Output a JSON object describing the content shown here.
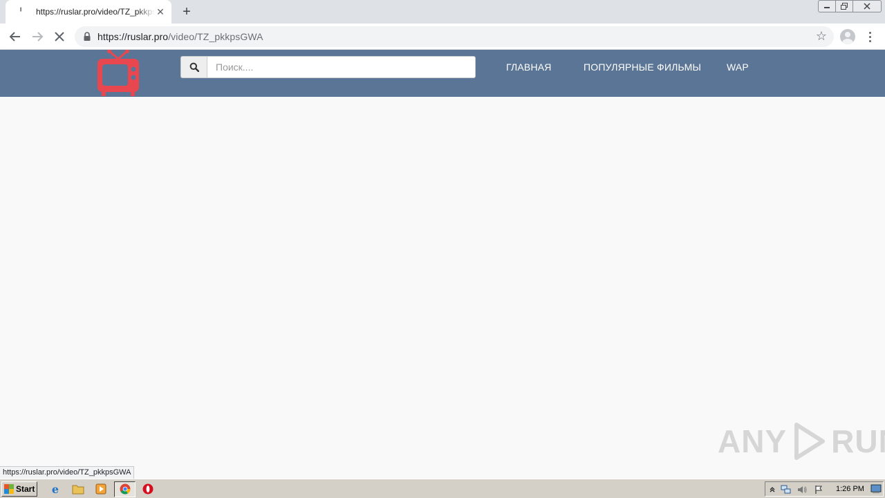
{
  "browser": {
    "tab": {
      "title": "https://ruslar.pro/video/TZ_pkkpsGWA",
      "close_glyph": "✕"
    },
    "new_tab_glyph": "+",
    "address": {
      "url_main": "https://ruslar.pro",
      "url_path": "/video/TZ_pkkpsGWA"
    },
    "status_text": "https://ruslar.pro/video/TZ_pkkpsGWA"
  },
  "site": {
    "search": {
      "placeholder": "Поиск...."
    },
    "nav": {
      "home": "ГЛАВНАЯ",
      "popular": "ПОПУЛЯРНЫЕ ФИЛЬМЫ",
      "wap": "WAP"
    },
    "colors": {
      "header_bg": "#5b7596",
      "logo_red": "#e8474f"
    }
  },
  "watermark": {
    "left": "ANY",
    "right": "RUN"
  },
  "taskbar": {
    "start_label": "Start",
    "clock": "1:26 PM"
  }
}
